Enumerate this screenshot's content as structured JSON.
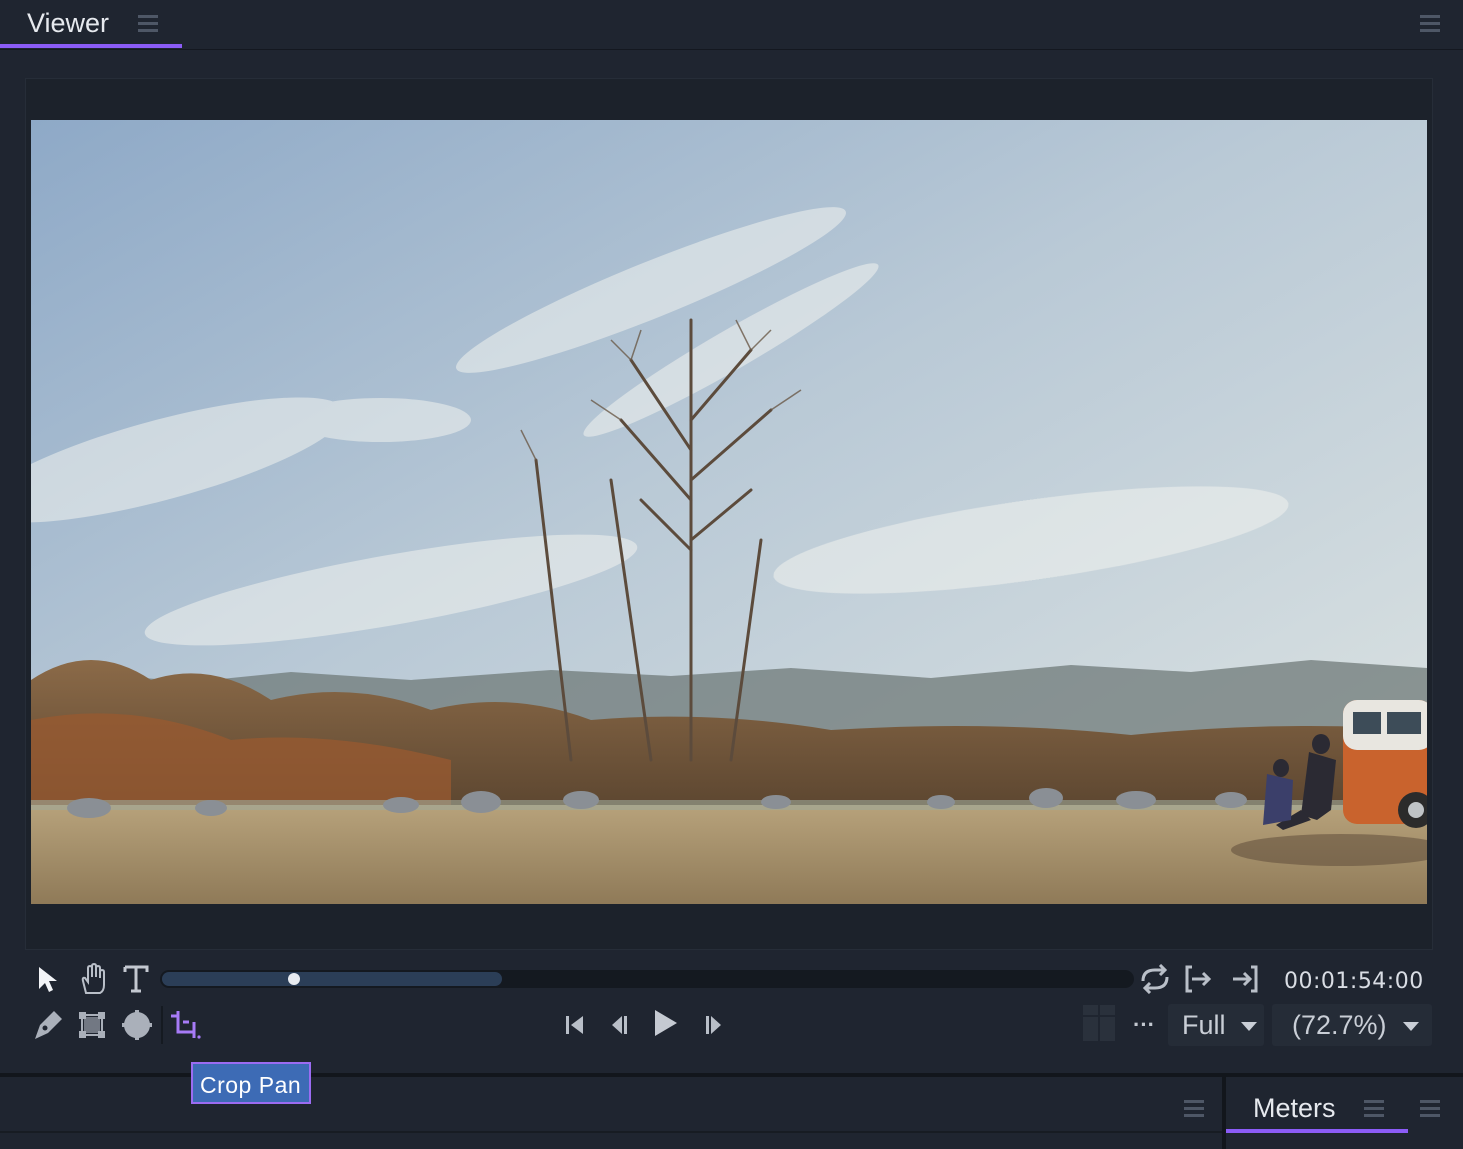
{
  "viewer": {
    "tab_label": "Viewer"
  },
  "playback": {
    "timecode": "00:01:54:00",
    "progress_fraction": 0.138,
    "loaded_fraction": 0.35
  },
  "toolbar": {
    "quality_label": "Full",
    "zoom_label": "(72.7%)",
    "more_label": "···",
    "active_tool": "crop-pan"
  },
  "tooltip": {
    "text": "Crop  Pan"
  },
  "bottom_panel": {
    "meters_tab_label": "Meters"
  },
  "colors": {
    "accent": "#8b5cf6",
    "tooltip_bg": "#3d6bb5",
    "panel_bg": "#1f2530"
  }
}
